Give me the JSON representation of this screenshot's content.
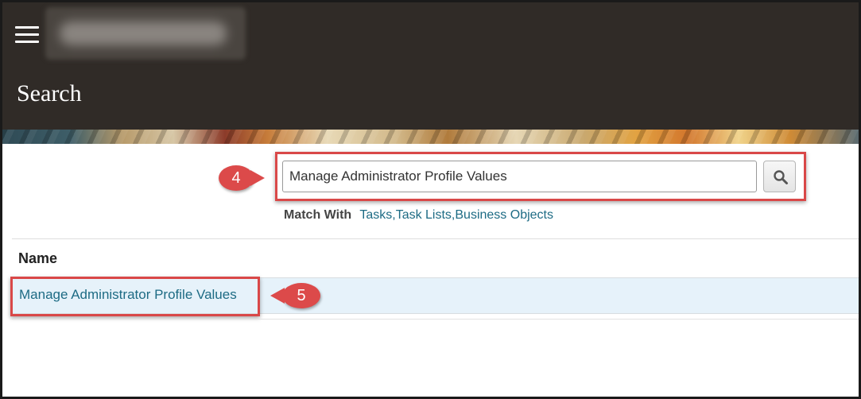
{
  "header": {
    "menu_icon": "hamburger-menu-icon",
    "page_title": "Search"
  },
  "search": {
    "value": "Manage Administrator Profile Values",
    "button_icon": "magnifier-icon",
    "match_with_label": "Match With",
    "match_with_value": "Tasks,Task Lists,Business Objects"
  },
  "results": {
    "column_header": "Name",
    "rows": [
      {
        "name": "Manage Administrator Profile Values"
      }
    ]
  },
  "callouts": {
    "step_search": "4",
    "step_result": "5",
    "color": "#dc4a4a"
  },
  "colors": {
    "header_bg": "#302b27",
    "link": "#1d6b84",
    "selected_row_bg": "#e6f2fa"
  }
}
